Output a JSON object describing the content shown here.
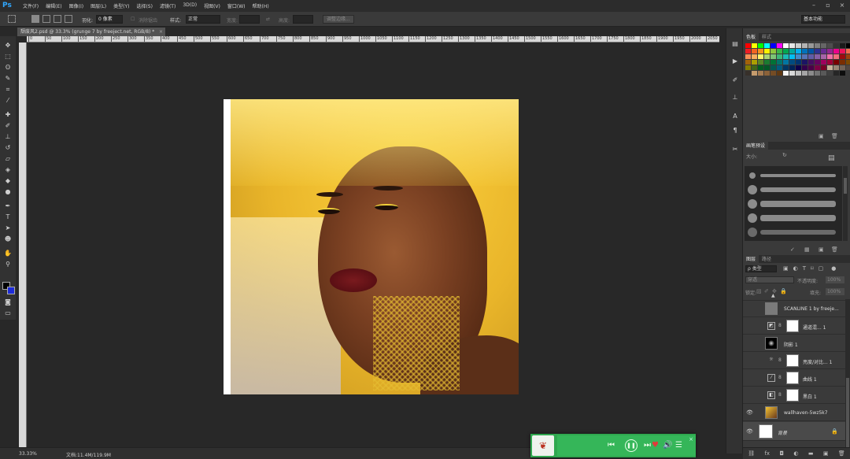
{
  "app": {
    "logo": "Ps",
    "menu": [
      "文件(F)",
      "编辑(E)",
      "图像(I)",
      "图层(L)",
      "类型(Y)",
      "选择(S)",
      "滤镜(T)",
      "3D(D)",
      "视图(V)",
      "窗口(W)",
      "帮助(H)"
    ],
    "window_controls": [
      "minimize-icon",
      "maximize-icon",
      "close-icon"
    ]
  },
  "options_bar": {
    "feather_label": "羽化:",
    "feather_value": "0 像素",
    "antialias_label": "消除锯齿",
    "style_label": "样式:",
    "style_value": "正常",
    "width_label": "宽度:",
    "height_label": "高度:",
    "refine_edge": "调整边缘...",
    "workspace_value": "基本功能"
  },
  "document": {
    "tab_title": "颓废风2.psd @ 33.3% (grunge 7 by freeject.net, RGB/8) *",
    "tab_close": "×"
  },
  "ruler": {
    "ticks": [
      "0",
      "50",
      "100",
      "150",
      "200",
      "250",
      "300",
      "350",
      "400",
      "450",
      "500",
      "550",
      "600",
      "650",
      "700",
      "750",
      "800",
      "850",
      "900",
      "950",
      "1000",
      "1050",
      "1100",
      "1150",
      "1200",
      "1250",
      "1300",
      "1350",
      "1400",
      "1450",
      "1500",
      "1550",
      "1600",
      "1650",
      "1700",
      "1750",
      "1800",
      "1850",
      "1900",
      "1950",
      "2000",
      "2050"
    ]
  },
  "status_bar": {
    "zoom": "33.33%",
    "doc_size": "文档:11.4M/119.9M"
  },
  "panels": {
    "swatches_tabs": [
      "色板",
      "样式"
    ],
    "swatch_colors": [
      "#ff0000",
      "#ffff00",
      "#00ff00",
      "#00ffff",
      "#0000ff",
      "#ff00ff",
      "#ffffff",
      "#e6e6e6",
      "#cccccc",
      "#b3b3b3",
      "#999999",
      "#808080",
      "#666666",
      "#4d4d4d",
      "#333333",
      "#1a1a1a",
      "#000000",
      "#ee1d24",
      "#f26522",
      "#f7941d",
      "#fff200",
      "#8dc63f",
      "#39b54a",
      "#00a651",
      "#00a99d",
      "#00aeef",
      "#0072bc",
      "#0054a6",
      "#2e3192",
      "#662d91",
      "#92278f",
      "#ec008c",
      "#ed145b",
      "#f26c4f",
      "#f68e55",
      "#fbaf5c",
      "#fff467",
      "#acd373",
      "#7cc576",
      "#3bb878",
      "#1abbb4",
      "#00bff3",
      "#438ccb",
      "#5574b9",
      "#605ca8",
      "#855fa8",
      "#a763a8",
      "#f06ea9",
      "#f26d7d",
      "#9e0b0f",
      "#a0410d",
      "#a3620a",
      "#aba000",
      "#598527",
      "#1a7b30",
      "#007236",
      "#00746b",
      "#0076a3",
      "#004b80",
      "#003471",
      "#1b1464",
      "#440e62",
      "#630460",
      "#9e005d",
      "#9e0039",
      "#790000",
      "#7b2e00",
      "#7d4900",
      "#827b00",
      "#406618",
      "#005e20",
      "#005826",
      "#005952",
      "#005b7f",
      "#003663",
      "#002157",
      "#0d004c",
      "#32004b",
      "#4b0049",
      "#7b0046",
      "#7a0026",
      "#c7b299",
      "#998675",
      "#736357",
      "#534741",
      "#37302a",
      "#c69c6d",
      "#a67c52",
      "#8c6239",
      "#754c24",
      "#603913",
      "#f5f5f5",
      "#d9d9d9",
      "#bfbfbf",
      "#a6a6a6",
      "#8c8c8c",
      "#737373",
      "#595959",
      "#404040",
      "#262626",
      "#0d0d0d"
    ],
    "brush_tabs": [
      "画笔预设"
    ],
    "brush_size_label": "大小:",
    "layers_tabs": [
      "图层",
      "路径"
    ],
    "layers_filter": "ρ 类型",
    "blend_mode": "穿透",
    "opacity_label": "不透明度:",
    "opacity_value": "100%",
    "lock_label": "锁定:",
    "fill_label": "填充:",
    "fill_value": "100%"
  },
  "layers": [
    {
      "name": "SCANLINE 1 by freeje...",
      "type": "pixel"
    },
    {
      "name": "通道混... 1",
      "type": "adjust"
    },
    {
      "name": "阴影 1",
      "type": "pixel-dark"
    },
    {
      "name": "亮度/对比... 1",
      "type": "adjust"
    },
    {
      "name": "曲线 1",
      "type": "adjust"
    },
    {
      "name": "黑白 1",
      "type": "adjust"
    },
    {
      "name": "wallhaven-5wz5k7",
      "type": "photo"
    },
    {
      "name": "背景",
      "type": "background"
    }
  ],
  "player": {
    "cover_icon": "music-cover-icon"
  }
}
